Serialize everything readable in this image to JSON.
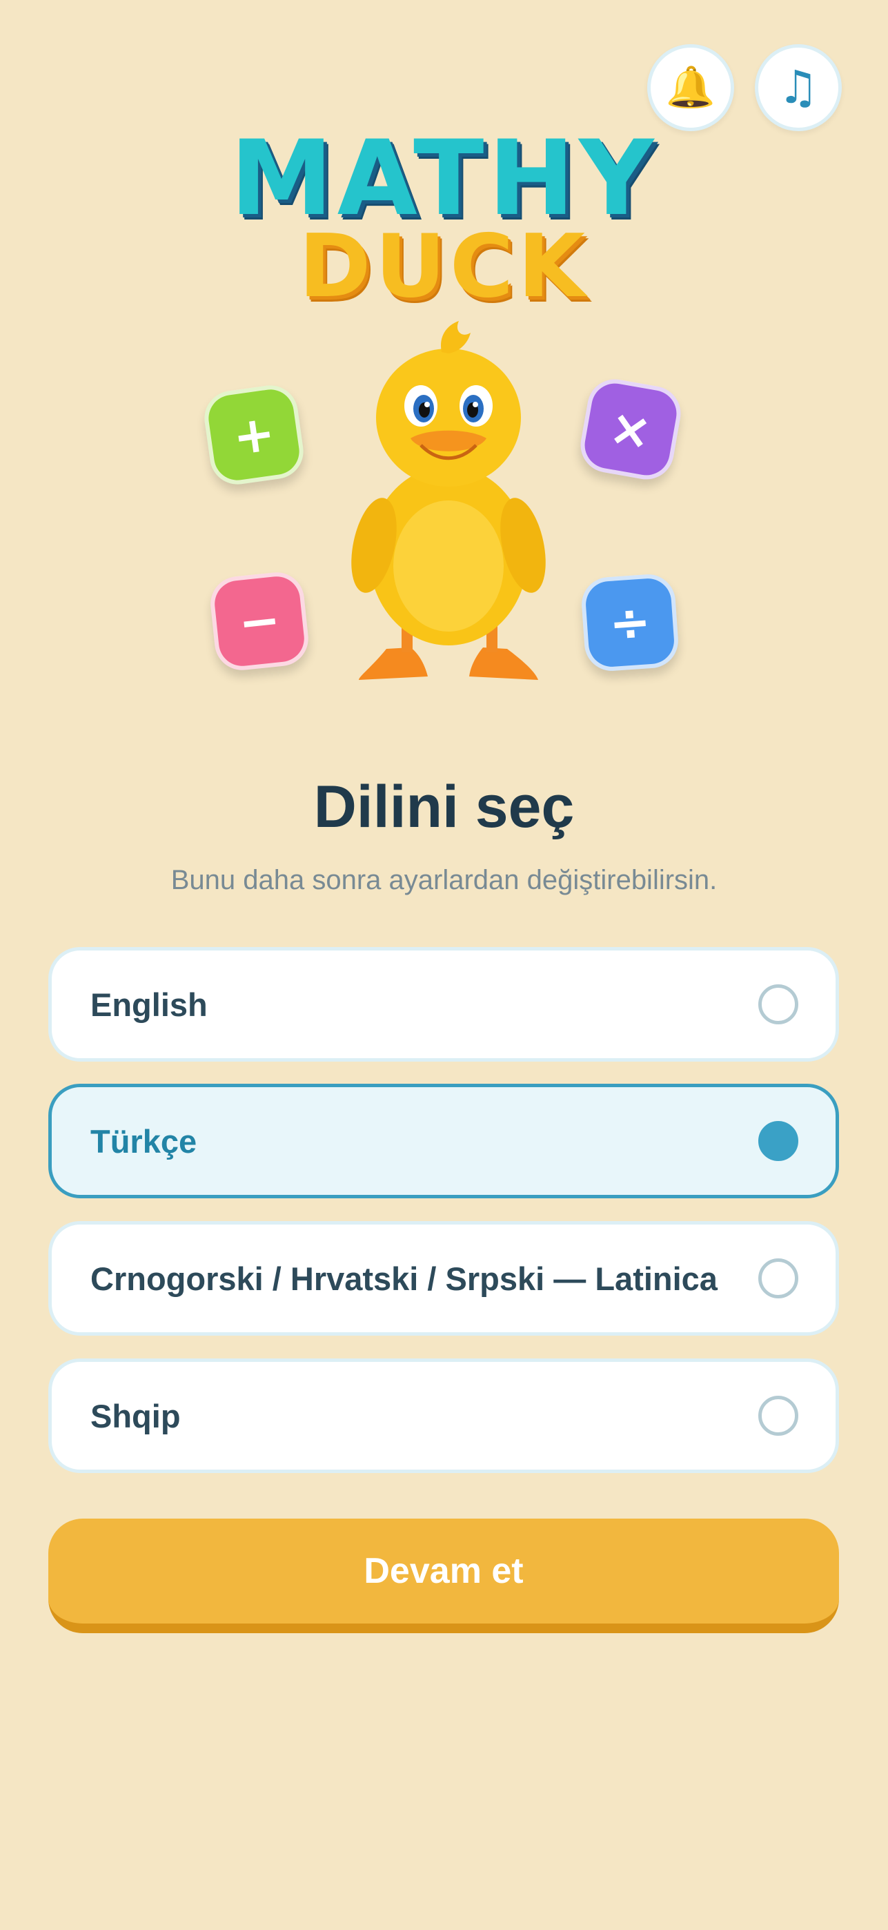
{
  "header": {
    "bell_icon": "bell-icon",
    "music_icon": "music-note-icon",
    "bell_glyph": "🔔",
    "music_glyph": "♫"
  },
  "logo": {
    "line1": "MATHY",
    "line2": "DUCK"
  },
  "operators": {
    "plus": "+",
    "times": "×",
    "minus": "−",
    "divide": "÷"
  },
  "title": "Dilini seç",
  "subtitle": "Bunu daha sonra ayarlardan değiştirebilirsin.",
  "languages": [
    {
      "label": "English",
      "selected": false
    },
    {
      "label": "Türkçe",
      "selected": true
    },
    {
      "label": "Crnogorski / Hrvatski / Srpski — Latinica",
      "selected": false
    },
    {
      "label": "Shqip",
      "selected": false
    }
  ],
  "continue_label": "Devam et",
  "colors": {
    "background": "#F5E6C4",
    "accent": "#2284A6",
    "button": "#F2B73E",
    "logo_teal": "#25C4CC",
    "logo_yellow": "#F7BD21"
  }
}
